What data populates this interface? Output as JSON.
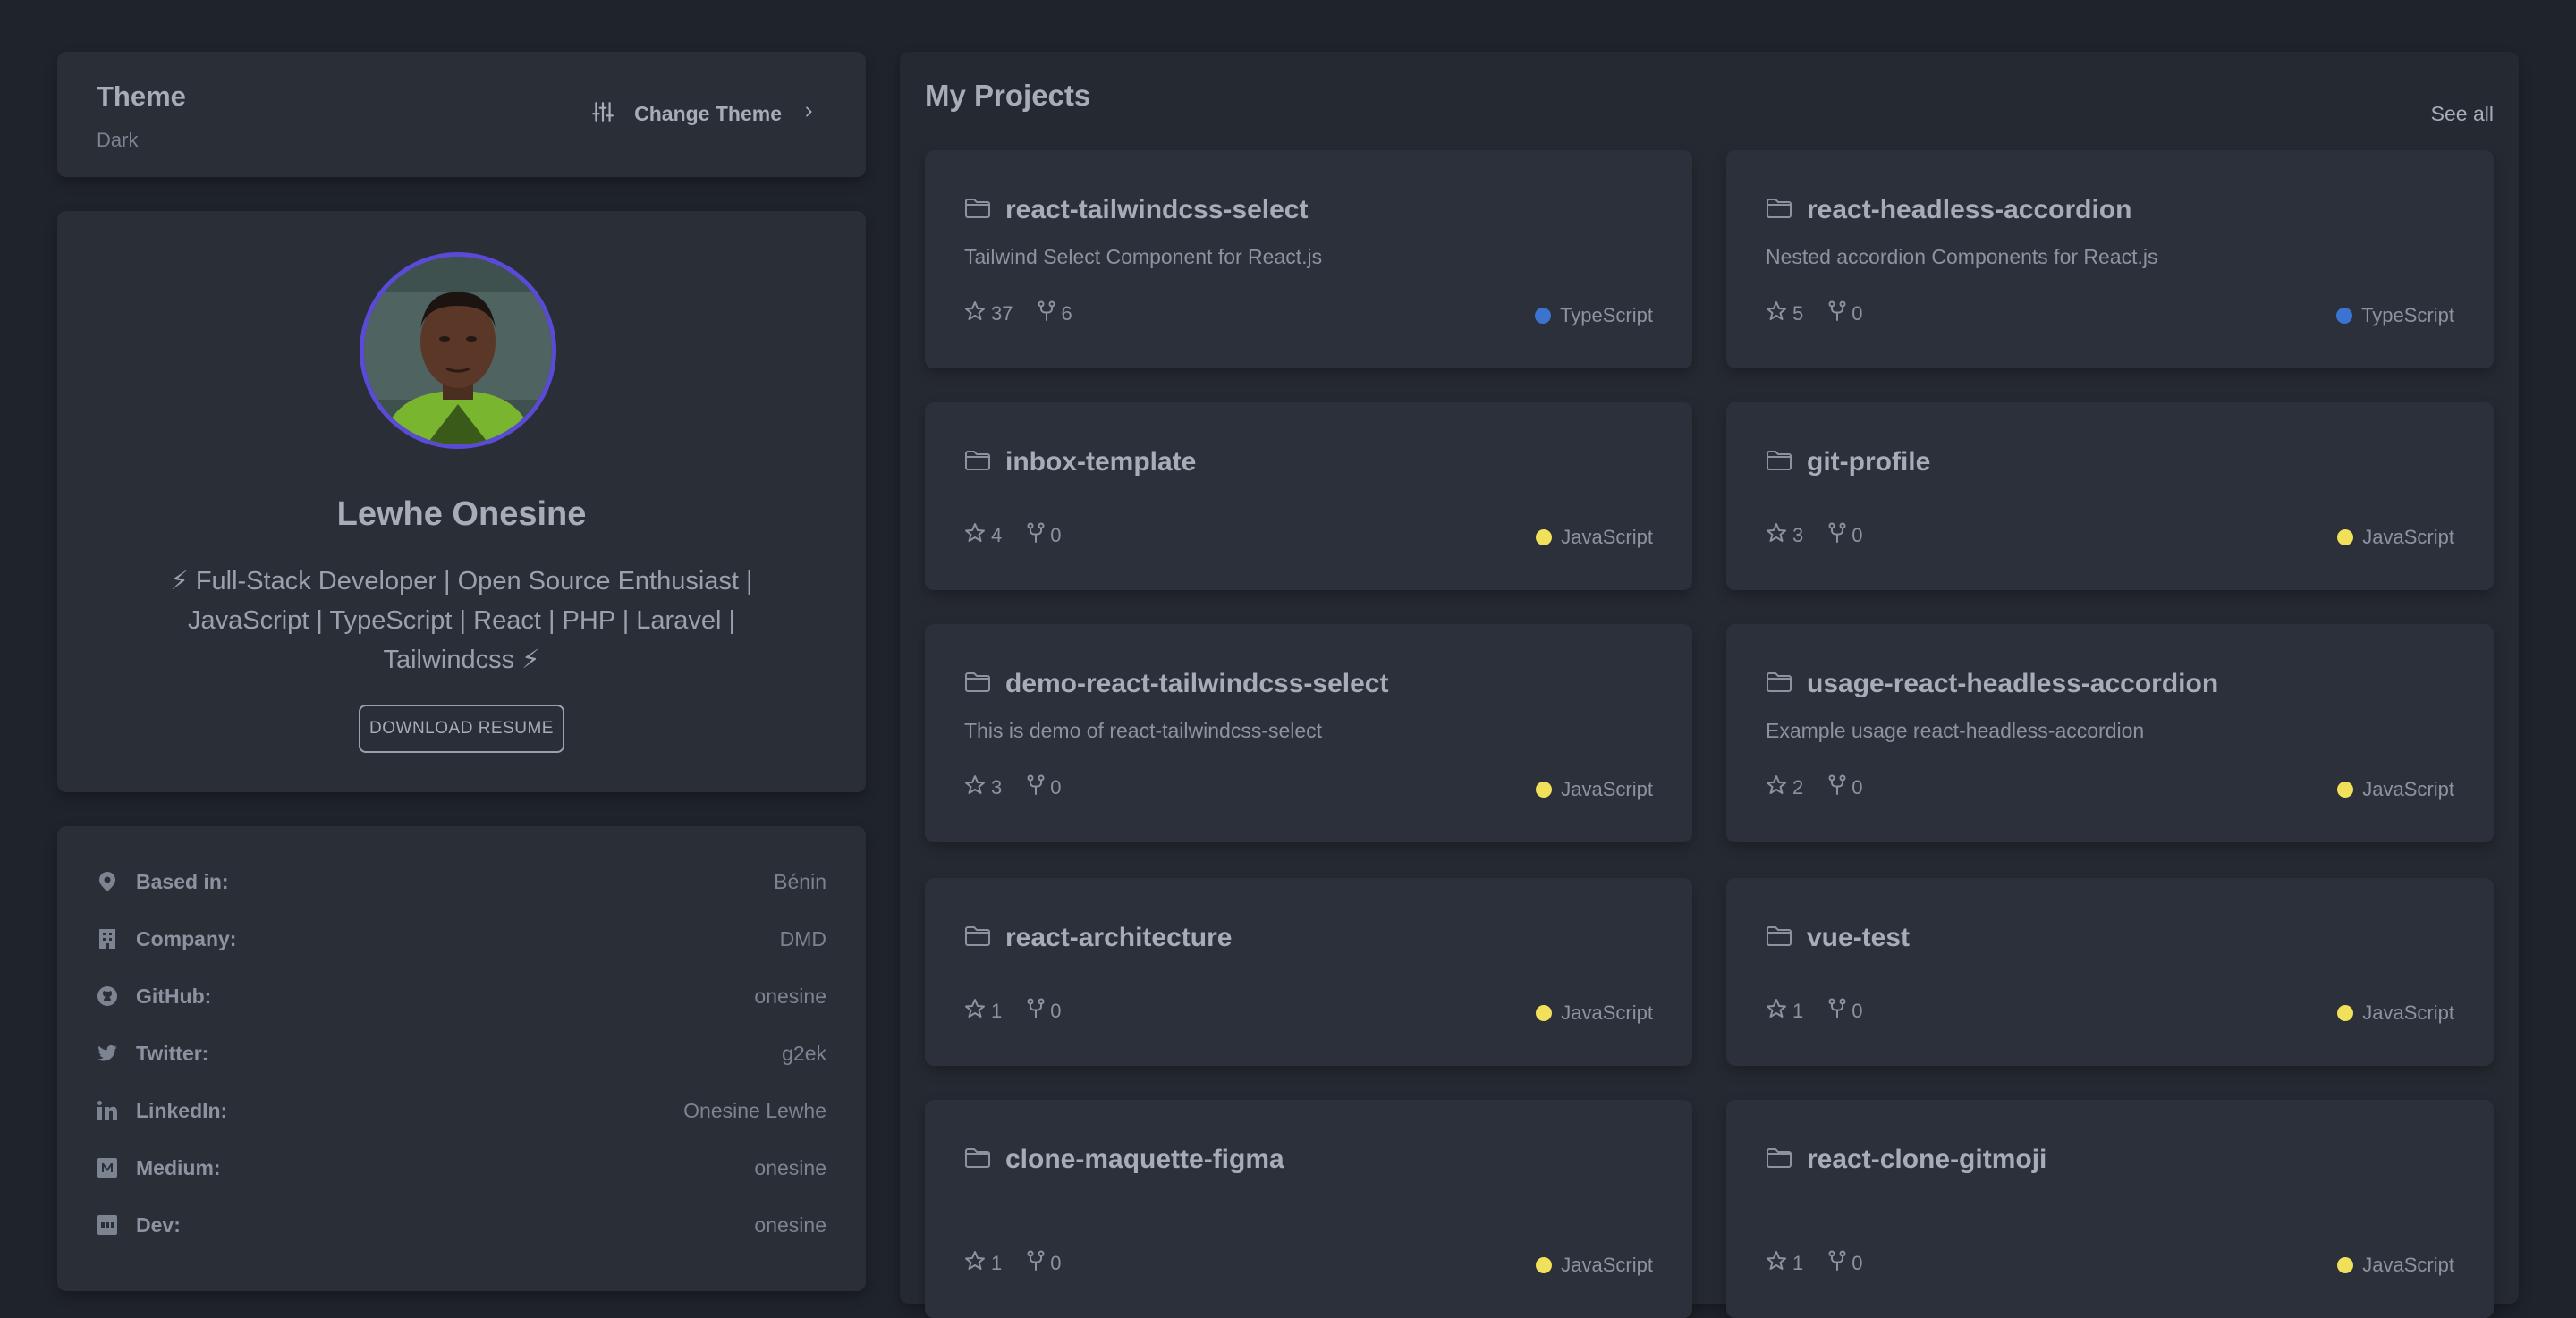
{
  "theme": {
    "title": "Theme",
    "current": "Dark",
    "change_label": "Change Theme"
  },
  "profile": {
    "name": "Lewhe Onesine",
    "bio_line1": "⚡ Full-Stack Developer | Open Source Enthusiast |",
    "bio_line2": "JavaScript | TypeScript | React | PHP | Laravel |",
    "bio_line3": "Tailwindcss ⚡",
    "resume_label": "DOWNLOAD RESUME"
  },
  "details": [
    {
      "icon": "location-pin-icon",
      "label": "Based in:",
      "value": "Bénin"
    },
    {
      "icon": "building-icon",
      "label": "Company:",
      "value": "DMD"
    },
    {
      "icon": "github-icon",
      "label": "GitHub:",
      "value": "onesine"
    },
    {
      "icon": "twitter-icon",
      "label": "Twitter:",
      "value": "g2ek"
    },
    {
      "icon": "linkedin-icon",
      "label": "LinkedIn:",
      "value": "Onesine Lewhe"
    },
    {
      "icon": "medium-icon",
      "label": "Medium:",
      "value": "onesine"
    },
    {
      "icon": "dev-icon",
      "label": "Dev:",
      "value": "onesine"
    }
  ],
  "projects": {
    "heading": "My Projects",
    "see_all": "See all",
    "items": [
      {
        "name": "react-tailwindcss-select",
        "description": "Tailwind Select Component for React.js",
        "stars": "37",
        "forks": "6",
        "language": "TypeScript",
        "lang_color": "#3b73d1"
      },
      {
        "name": "react-headless-accordion",
        "description": "Nested accordion Components for React.js",
        "stars": "5",
        "forks": "0",
        "language": "TypeScript",
        "lang_color": "#3b73d1"
      },
      {
        "name": "inbox-template",
        "description": "",
        "stars": "4",
        "forks": "0",
        "language": "JavaScript",
        "lang_color": "#f1e05a"
      },
      {
        "name": "git-profile",
        "description": "",
        "stars": "3",
        "forks": "0",
        "language": "JavaScript",
        "lang_color": "#f1e05a"
      },
      {
        "name": "demo-react-tailwindcss-select",
        "description": "This is demo of react-tailwindcss-select",
        "stars": "3",
        "forks": "0",
        "language": "JavaScript",
        "lang_color": "#f1e05a"
      },
      {
        "name": "usage-react-headless-accordion",
        "description": "Example usage react-headless-accordion",
        "stars": "2",
        "forks": "0",
        "language": "JavaScript",
        "lang_color": "#f1e05a"
      },
      {
        "name": "react-architecture",
        "description": "",
        "stars": "1",
        "forks": "0",
        "language": "JavaScript",
        "lang_color": "#f1e05a"
      },
      {
        "name": "vue-test",
        "description": "",
        "stars": "1",
        "forks": "0",
        "language": "JavaScript",
        "lang_color": "#f1e05a"
      },
      {
        "name": "clone-maquette-figma",
        "description": "",
        "stars": "1",
        "forks": "0",
        "language": "JavaScript",
        "lang_color": "#f1e05a"
      },
      {
        "name": "react-clone-gitmoji",
        "description": "",
        "stars": "1",
        "forks": "0",
        "language": "JavaScript",
        "lang_color": "#f1e05a"
      }
    ]
  }
}
